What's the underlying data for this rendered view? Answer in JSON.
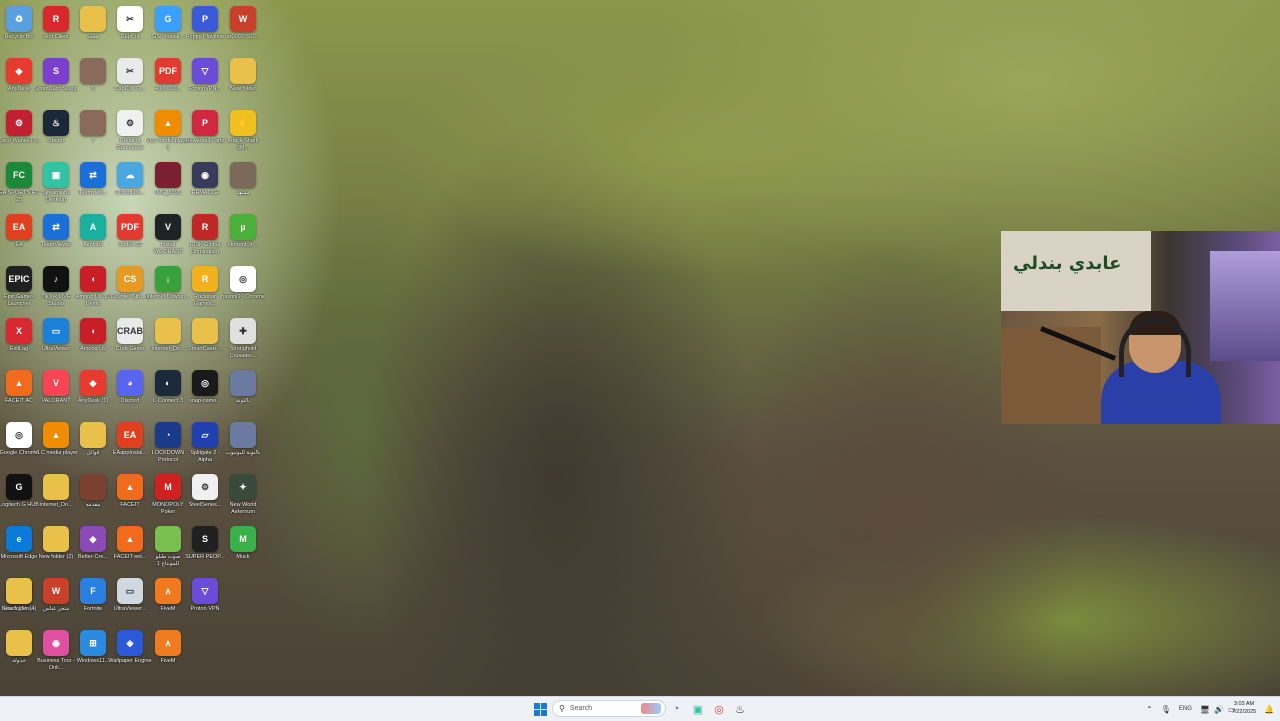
{
  "desktop_icons": [
    {
      "label": "Recycle Bin",
      "color": "#5aa0e0",
      "glyph": "♻"
    },
    {
      "label": "Riot Client",
      "color": "#d8282e",
      "glyph": "R"
    },
    {
      "label": "مجلد",
      "color": "#e8c04a",
      "glyph": ""
    },
    {
      "label": "CapCut",
      "color": "#ffffff",
      "glyph": "✂"
    },
    {
      "label": "GSP install...",
      "color": "#3aa0ff",
      "glyph": "G"
    },
    {
      "label": "Poppy Playtime",
      "color": "#3a5ad8",
      "glyph": "P"
    },
    {
      "label": "ar0002 ISO...",
      "color": "#c8402a",
      "glyph": "W"
    },
    {
      "label": "AnyDesk",
      "color": "#e63b2e",
      "glyph": "◆"
    },
    {
      "label": "SmartCard Studio",
      "color": "#7b3fd0",
      "glyph": "S"
    },
    {
      "label": "6",
      "color": "#8a6a5a",
      "glyph": ""
    },
    {
      "label": "CapCut 71...",
      "color": "#eaeaea",
      "glyph": "✂"
    },
    {
      "label": "4000000...",
      "color": "#e23a2e",
      "glyph": "PDF"
    },
    {
      "label": "ProtonVPN...",
      "color": "#6a4cd8",
      "glyph": "▽"
    },
    {
      "label": "New folder",
      "color": "#e8c04a",
      "glyph": ""
    },
    {
      "label": "Cisco Webex Pl...",
      "color": "#c02030",
      "glyph": "⚙"
    },
    {
      "label": "Steam",
      "color": "#1b2838",
      "glyph": "♨"
    },
    {
      "label": "7",
      "color": "#8a6a5a",
      "glyph": ""
    },
    {
      "label": "Creating Gamebase",
      "color": "#f0f0f0",
      "glyph": "⚙"
    },
    {
      "label": "VLC media player 1",
      "color": "#f08c00",
      "glyph": "▲"
    },
    {
      "label": "Powerball Party",
      "color": "#d02840",
      "glyph": "P"
    },
    {
      "label": "Attack Shark 3M...",
      "color": "#f0c020",
      "glyph": "⚡"
    },
    {
      "label": "EA SPORTS FC 25",
      "color": "#1a8a3a",
      "glyph": "FC"
    },
    {
      "label": "Streamlabs Desktop",
      "color": "#31c3a2",
      "glyph": "▣"
    },
    {
      "label": "Teamview...",
      "color": "#1a6fd8",
      "glyph": "⇄"
    },
    {
      "label": "Cloudflare...",
      "color": "#4aa8e0",
      "glyph": "☁"
    },
    {
      "label": "IMG_8398",
      "color": "#7a2030",
      "glyph": ""
    },
    {
      "label": "REMATCH",
      "color": "#3a3a5a",
      "glyph": "◉"
    },
    {
      "label": "مشهد",
      "color": "#7a6a5a",
      "glyph": ""
    },
    {
      "label": "EA",
      "color": "#e0401e",
      "glyph": "EA"
    },
    {
      "label": "TeamViewer",
      "color": "#1a6fd8",
      "glyph": "⇄"
    },
    {
      "label": "Aimlabs",
      "color": "#1ab0a0",
      "glyph": "A"
    },
    {
      "label": "Codex 32",
      "color": "#e23a2e",
      "glyph": "PDF"
    },
    {
      "label": "Install VALORANT",
      "color": "#1f2326",
      "glyph": "V"
    },
    {
      "label": "RISK Global Domination",
      "color": "#c02828",
      "glyph": "R"
    },
    {
      "label": "utorrent_in...",
      "color": "#4ab03a",
      "glyph": "µ"
    },
    {
      "label": "Epic Games Launcher",
      "color": "#202020",
      "glyph": "EPIC"
    },
    {
      "label": "TikTok LIVE Studio",
      "color": "#111111",
      "glyph": "♪"
    },
    {
      "label": "Among Us 3D Demo",
      "color": "#c81e28",
      "glyph": "◖"
    },
    {
      "label": "Counter-Stri... 2",
      "color": "#e89a20",
      "glyph": "CS"
    },
    {
      "label": "Internet Downlo...",
      "color": "#3aa03a",
      "glyph": "↓"
    },
    {
      "label": "Rockstar Games...",
      "color": "#f2b01e",
      "glyph": "R"
    },
    {
      "label": "hasoni1 - Chrome",
      "color": "#ffffff",
      "glyph": "◎"
    },
    {
      "label": "ExitLag",
      "color": "#d82830",
      "glyph": "X"
    },
    {
      "label": "UltraViewer",
      "color": "#1a80d8",
      "glyph": "▭"
    },
    {
      "label": "Among Us",
      "color": "#c81e28",
      "glyph": "◖"
    },
    {
      "label": "Crab Game",
      "color": "#eaeaea",
      "glyph": "CRAB"
    },
    {
      "label": "Internet_Do...",
      "color": "#e8c04a",
      "glyph": ""
    },
    {
      "label": "SmartCast+...",
      "color": "#e8c04a",
      "glyph": ""
    },
    {
      "label": "Stronghold Crusader...",
      "color": "#e0e0e0",
      "glyph": "✚"
    },
    {
      "label": "FACEIT AC",
      "color": "#f26a1b",
      "glyph": "▲"
    },
    {
      "label": "VALORANT",
      "color": "#fa4454",
      "glyph": "V"
    },
    {
      "label": "AnyDesk (1)",
      "color": "#e63b2e",
      "glyph": "◆"
    },
    {
      "label": "Discord",
      "color": "#5865f2",
      "glyph": "◕"
    },
    {
      "label": "L-Connect 3",
      "color": "#1a2a3a",
      "glyph": "◐"
    },
    {
      "label": "snap-came...",
      "color": "#1a1a1a",
      "glyph": "◎"
    },
    {
      "label": "بالتوبة",
      "color": "#6a7aa0",
      "glyph": ""
    },
    {
      "label": "Google Chrome",
      "color": "#ffffff",
      "glyph": "◎"
    },
    {
      "label": "VLC media player",
      "color": "#f08c00",
      "glyph": "▲"
    },
    {
      "label": "قوائل",
      "color": "#e8c04a",
      "glyph": ""
    },
    {
      "label": "EAappInstal...",
      "color": "#e0401e",
      "glyph": "EA"
    },
    {
      "label": "LOCKDOWN Protocol",
      "color": "#1a3a8a",
      "glyph": "◔"
    },
    {
      "label": "Splitgate 2 - Alpha",
      "color": "#2040b0",
      "glyph": "▱"
    },
    {
      "label": "بالتوبة لليوتيوب",
      "color": "#6a7aa0",
      "glyph": ""
    },
    {
      "label": "Logitech G HUB",
      "color": "#111111",
      "glyph": "G"
    },
    {
      "label": "Internet_Do...",
      "color": "#e8c04a",
      "glyph": ""
    },
    {
      "label": "مقدمه",
      "color": "#7a4030",
      "glyph": ""
    },
    {
      "label": "FACEIT",
      "color": "#f26a1b",
      "glyph": "▲"
    },
    {
      "label": "MONOPOLY Poker",
      "color": "#d02020",
      "glyph": "M"
    },
    {
      "label": "SteelSeries...",
      "color": "#f0f0f0",
      "glyph": "⚙"
    },
    {
      "label": "New World Aeternum",
      "color": "#3a4a3a",
      "glyph": "✦"
    },
    {
      "label": "Microsoft Edge",
      "color": "#0a7ad8",
      "glyph": "e"
    },
    {
      "label": "New folder (2)",
      "color": "#e8c04a",
      "glyph": ""
    },
    {
      "label": "Better-Cre...",
      "color": "#8a4ab8",
      "glyph": "◆"
    },
    {
      "label": "FACEIT-set...",
      "color": "#f26a1b",
      "glyph": "▲"
    },
    {
      "label": "صوت طبلو للمونتاج 1",
      "color": "#7ac050",
      "glyph": ""
    },
    {
      "label": "SUPER PEOP...",
      "color": "#202020",
      "glyph": "S"
    },
    {
      "label": "Muck",
      "color": "#3ab04a",
      "glyph": "M"
    },
    {
      "label": "Attack_Sha...",
      "color": "#f0c020",
      "glyph": "⚡"
    },
    {
      "label": "New folder (4)",
      "color": "#e8c04a",
      "glyph": ""
    },
    {
      "label": "متجر عباس",
      "color": "#c8402a",
      "glyph": "W"
    },
    {
      "label": "Fortnite",
      "color": "#2a80e0",
      "glyph": "F"
    },
    {
      "label": "UltraViewer...",
      "color": "#d0d8e0",
      "glyph": "▭"
    },
    {
      "label": "FiveM",
      "color": "#f07a20",
      "glyph": "∧"
    },
    {
      "label": "Proton VPN",
      "color": "#6a4cd8",
      "glyph": "▽"
    },
    {
      "label": "جدولة",
      "color": "#e8c04a",
      "glyph": ""
    },
    {
      "label": "Business Tour - Onli...",
      "color": "#e050a0",
      "glyph": "◉"
    },
    {
      "label": "Windows11...",
      "color": "#2a8ae0",
      "glyph": "⊞"
    },
    {
      "label": "Wallpaper Engine",
      "color": "#2a5ad8",
      "glyph": "◈"
    },
    {
      "label": "FiveM",
      "color": "#f07a20",
      "glyph": "∧"
    }
  ],
  "webcam": {
    "poster_text": "عابدي بندلي"
  },
  "taskbar": {
    "search_placeholder": "Search",
    "language": "ENG",
    "time": "3:03 AM",
    "date": "7/22/2025",
    "pinned": [
      {
        "name": "teams",
        "glyph": "◔",
        "color": "#6264a7"
      },
      {
        "name": "streamlabs",
        "glyph": "▣",
        "color": "#31c3a2"
      },
      {
        "name": "chrome",
        "glyph": "◎",
        "color": "#e44134"
      },
      {
        "name": "steam",
        "glyph": "♨",
        "color": "#1b2838"
      }
    ]
  }
}
